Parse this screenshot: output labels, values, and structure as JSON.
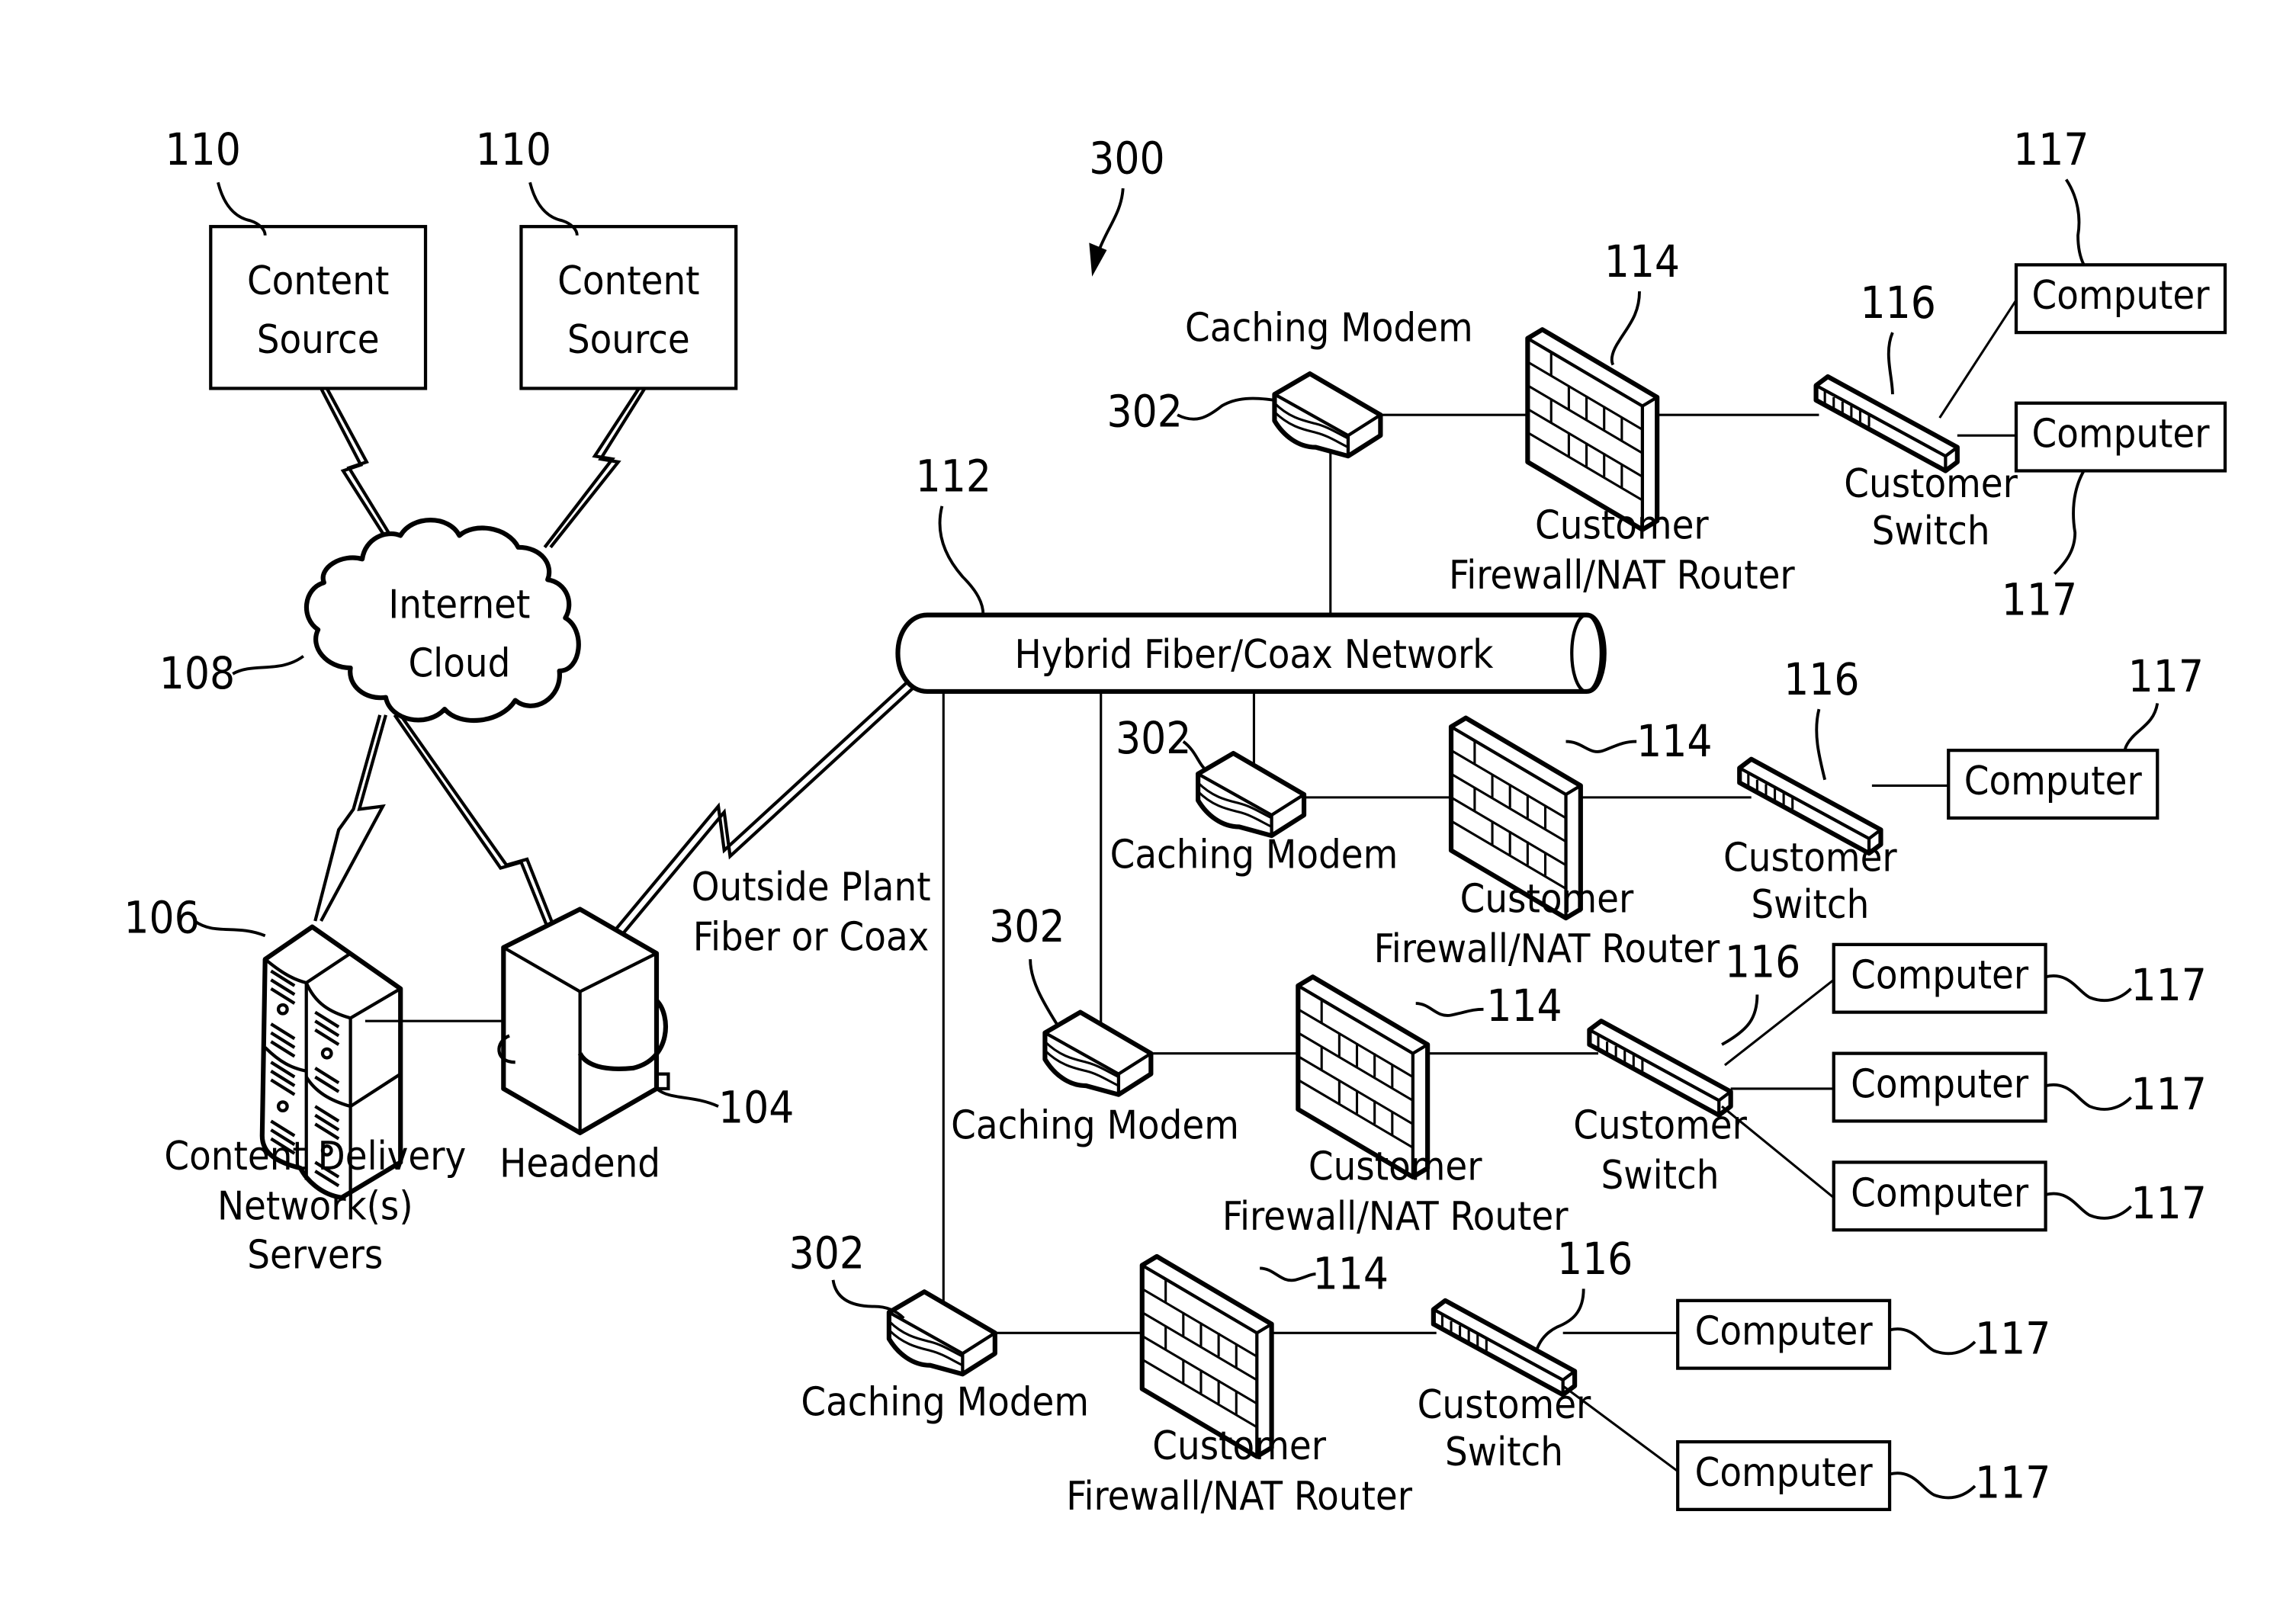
{
  "figure": {
    "ref": "300",
    "content_sources": [
      {
        "label_line1": "Content",
        "label_line2": "Source",
        "ref": "110"
      },
      {
        "label_line1": "Content",
        "label_line2": "Source",
        "ref": "110"
      }
    ],
    "internet": {
      "label_line1": "Internet",
      "label_line2": "Cloud",
      "ref": "108"
    },
    "cdn": {
      "label_line1": "Content Delivery",
      "label_line2": "Network(s)",
      "label_line3": "Servers",
      "ref": "106"
    },
    "headend": {
      "label": "Headend",
      "ref": "104"
    },
    "outside_plant": {
      "label_line1": "Outside Plant",
      "label_line2": "Fiber or Coax"
    },
    "hfc": {
      "label": "Hybrid Fiber/Coax Network",
      "ref": "112"
    },
    "branches": [
      {
        "modem": {
          "label": "Caching Modem",
          "ref": "302"
        },
        "firewall": {
          "label_line1": "Customer",
          "label_line2": "Firewall/NAT Router",
          "ref": "114"
        },
        "switch": {
          "label_line1": "Customer",
          "label_line2": "Switch",
          "ref": "116"
        },
        "computers": [
          {
            "label": "Computer",
            "ref": "117"
          },
          {
            "label": "Computer",
            "ref": "117"
          }
        ]
      },
      {
        "modem": {
          "label": "Caching Modem",
          "ref": "302"
        },
        "firewall": {
          "label_line1": "Customer",
          "label_line2": "Firewall/NAT Router",
          "ref": "114"
        },
        "switch": {
          "label_line1": "Customer",
          "label_line2": "Switch",
          "ref": "116"
        },
        "computers": [
          {
            "label": "Computer",
            "ref": "117"
          }
        ]
      },
      {
        "modem": {
          "label": "Caching Modem",
          "ref": "302"
        },
        "firewall": {
          "label_line1": "Customer",
          "label_line2": "Firewall/NAT Router",
          "ref": "114"
        },
        "switch": {
          "label_line1": "Customer",
          "label_line2": "Switch",
          "ref": "116"
        },
        "computers": [
          {
            "label": "Computer",
            "ref": "117"
          },
          {
            "label": "Computer",
            "ref": "117"
          },
          {
            "label": "Computer",
            "ref": "117"
          }
        ]
      },
      {
        "modem": {
          "label": "Caching Modem",
          "ref": "302"
        },
        "firewall": {
          "label_line1": "Customer",
          "label_line2": "Firewall/NAT Router",
          "ref": "114"
        },
        "switch": {
          "label_line1": "Customer",
          "label_line2": "Switch",
          "ref": "116"
        },
        "computers": [
          {
            "label": "Computer",
            "ref": "117"
          },
          {
            "label": "Computer",
            "ref": "117"
          }
        ]
      }
    ]
  }
}
